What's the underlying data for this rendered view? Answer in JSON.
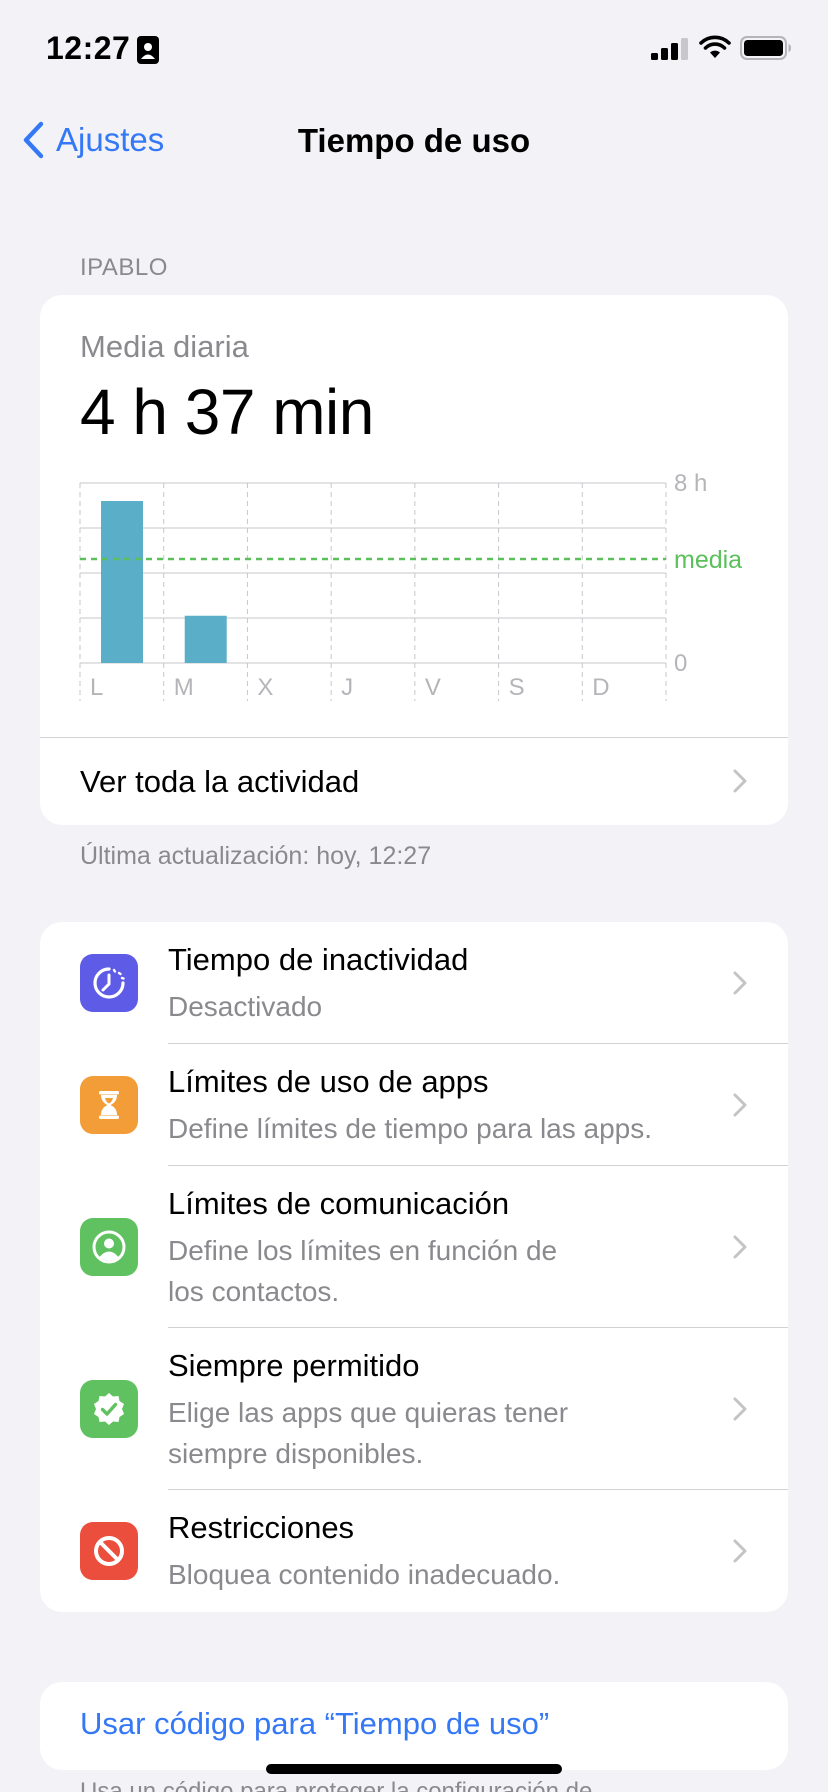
{
  "status_bar": {
    "time": "12:27"
  },
  "nav": {
    "back_label": "Ajustes",
    "title": "Tiempo de uso"
  },
  "section_header": "IPABLO",
  "usage": {
    "avg_label": "Media diaria",
    "avg_value": "4 h 37 min",
    "see_all_label": "Ver toda la actividad",
    "last_update": "Última actualización: hoy, 12:27"
  },
  "chart_data": {
    "type": "bar",
    "categories": [
      "L",
      "M",
      "X",
      "J",
      "V",
      "S",
      "D"
    ],
    "values": [
      7.2,
      2.1,
      0,
      0,
      0,
      0,
      0
    ],
    "average": 4.62,
    "y_ticks": [
      "8 h",
      "0"
    ],
    "avg_label": "media",
    "ylim": [
      0,
      8
    ],
    "colors": {
      "bar": "#5aaec8",
      "average": "#5bc05b",
      "grid": "#c7c7cc"
    }
  },
  "settings": [
    {
      "title": "Tiempo de inactividad",
      "subtitle_lines": [
        "Desactivado"
      ],
      "icon": "downtime-icon",
      "color": "#5e5ce6"
    },
    {
      "title": "Límites de uso de apps",
      "subtitle_lines": [
        "Define límites de tiempo para las apps."
      ],
      "icon": "hourglass-icon",
      "color": "#f29d38"
    },
    {
      "title": "Límites de comunicación",
      "subtitle_lines": [
        "Define los límites en función de",
        "los contactos."
      ],
      "icon": "contact-icon",
      "color": "#5fc15f"
    },
    {
      "title": "Siempre permitido",
      "subtitle_lines": [
        "Elige las apps que quieras tener",
        "siempre disponibles."
      ],
      "icon": "checkmark-badge-icon",
      "color": "#5fc15f"
    },
    {
      "title": "Restricciones",
      "subtitle_lines": [
        "Bloquea contenido inadecuado."
      ],
      "icon": "restriction-icon",
      "color": "#eb4e3d"
    }
  ],
  "passcode": {
    "label": "Usar código para “Tiempo de uso”",
    "note": "Usa un código para proteger la configuración de"
  }
}
